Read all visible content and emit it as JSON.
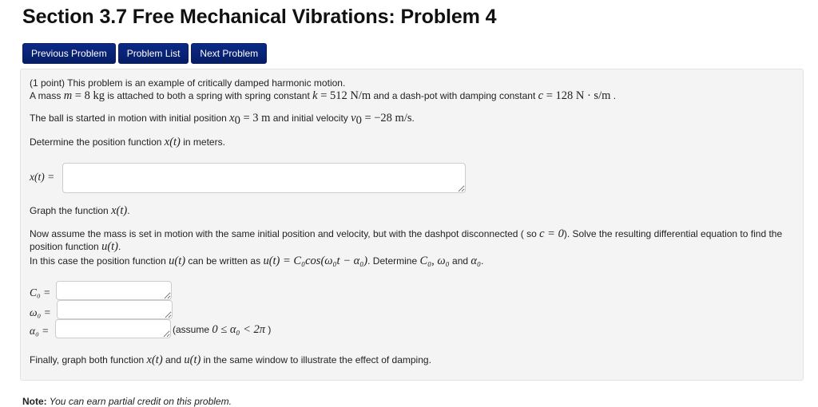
{
  "page": {
    "title": "Section 3.7 Free Mechanical Vibrations: Problem 4"
  },
  "nav": {
    "previous": "Previous Problem",
    "list": "Problem List",
    "next": "Next Problem",
    "button_color": "#0b2a86"
  },
  "problem": {
    "intro": "(1 point) This problem is an example of critically damped harmonic motion.",
    "mass_sentence": {
      "prefix": "A mass ",
      "m_var": "m",
      "m_val": " = 8 kg",
      "mid1": " is attached to both a spring with spring constant ",
      "k_var": "k",
      "k_val": " = 512 N/m",
      "mid2": " and a dash-pot with damping constant ",
      "c_var": "c",
      "c_val": " = 128 N · s/m",
      "suffix": " ."
    },
    "initial_sentence": {
      "prefix": "The ball is started in motion with initial position ",
      "x0_var": "x",
      "x0_sub": "0",
      "x0_val": " = 3 m",
      "mid": " and initial velocity ",
      "v0_var": "v",
      "v0_sub": "0",
      "v0_val": " = −28 m/s",
      "suffix": "."
    },
    "determine_x": {
      "prefix": "Determine the position function ",
      "expr": "x(t)",
      "suffix": " in meters."
    },
    "x_label": "x(t) =",
    "x_value": "",
    "graph_x": {
      "prefix": "Graph the function ",
      "expr": "x(t)",
      "suffix": "."
    },
    "undamped_sentence": {
      "prefix": "Now assume the mass is set in motion with the same initial position and velocity, but with the dashpot disconnected ( so ",
      "c_expr": "c = 0",
      "suffix": "). Solve the resulting differential equation to find the",
      "line2_prefix": "position function ",
      "line2_expr": "u(t)",
      "line2_suffix": "."
    },
    "form_sentence": {
      "prefix": "In this case the position function ",
      "u_expr": "u(t)",
      "mid": " can be written as ",
      "formula": "u(t) = C₀cos(ω₀t − α₀)",
      "mid2": ". Determine ",
      "vars": "C₀, ω₀",
      "and": " and ",
      "alpha": "α₀",
      "suffix": "."
    },
    "fields": [
      {
        "label": "C₀ =",
        "value": ""
      },
      {
        "label": "ω₀ =",
        "value": ""
      },
      {
        "label": "α₀ =",
        "value": ""
      }
    ],
    "alpha_hint": {
      "open": "(assume ",
      "expr": "0 ≤ α₀ < 2π",
      "close": " )"
    },
    "final_sentence": {
      "prefix": "Finally, graph both function ",
      "x_expr": "x(t)",
      "mid": " and ",
      "u_expr": "u(t)",
      "suffix": " in the same window to illustrate the effect of damping."
    }
  },
  "note": {
    "label": "Note:",
    "text": " You can earn partial credit on this problem."
  }
}
